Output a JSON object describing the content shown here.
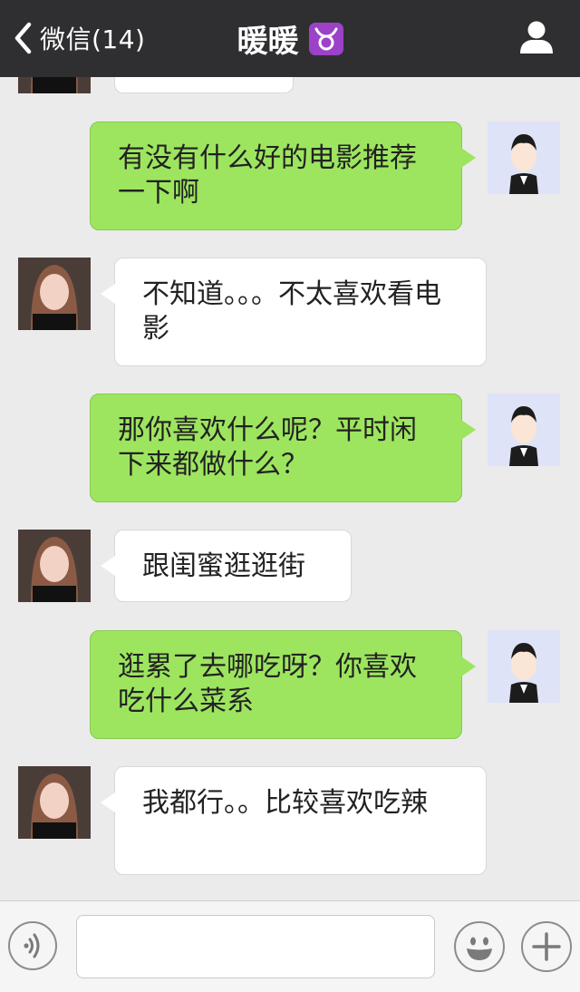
{
  "header": {
    "back_label": "微信(14)",
    "title": "暖暖",
    "title_emoji_icon": "taurus-icon",
    "profile_icon": "person-icon"
  },
  "messages": [
    {
      "side": "in",
      "text": ""
    },
    {
      "side": "out",
      "text": "有没有什么好的电影推荐一下啊"
    },
    {
      "side": "in",
      "text": "不知道。。。不太喜欢看电影"
    },
    {
      "side": "out",
      "text": "那你喜欢什么呢？平时闲下来都做什么？"
    },
    {
      "side": "in",
      "text": "跟闺蜜逛逛街"
    },
    {
      "side": "out",
      "text": "逛累了去哪吃呀？你喜欢吃什么菜系"
    },
    {
      "side": "in",
      "text": "我都行。。比较喜欢吃辣"
    }
  ],
  "input_bar": {
    "voice_icon": "voice-icon",
    "input_value": "",
    "input_placeholder": "",
    "emoji_icon": "smiley-icon",
    "plus_icon": "plus-icon"
  },
  "colors": {
    "header_bg": "#2f2f31",
    "outgoing_bubble": "#9de55f",
    "incoming_bubble": "#ffffff",
    "chat_bg": "#ebebeb"
  }
}
